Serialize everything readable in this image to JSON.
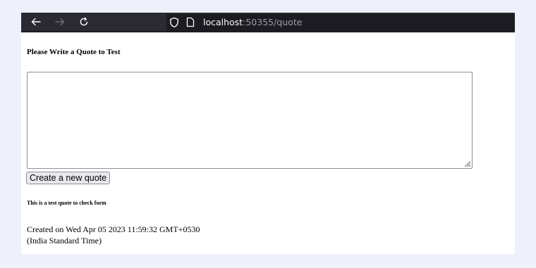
{
  "browser": {
    "url_host": "localhost",
    "url_rest": ":50355/quote"
  },
  "form": {
    "heading": "Please Write a Quote to Test",
    "textarea_value": "",
    "submit_label": "Create a new quote"
  },
  "quote": {
    "text": "This is a test quote to check form",
    "created_line1": "Created on Wed Apr 05 2023 11:59:32 GMT+0530",
    "created_line2": "(India Standard Time)"
  }
}
